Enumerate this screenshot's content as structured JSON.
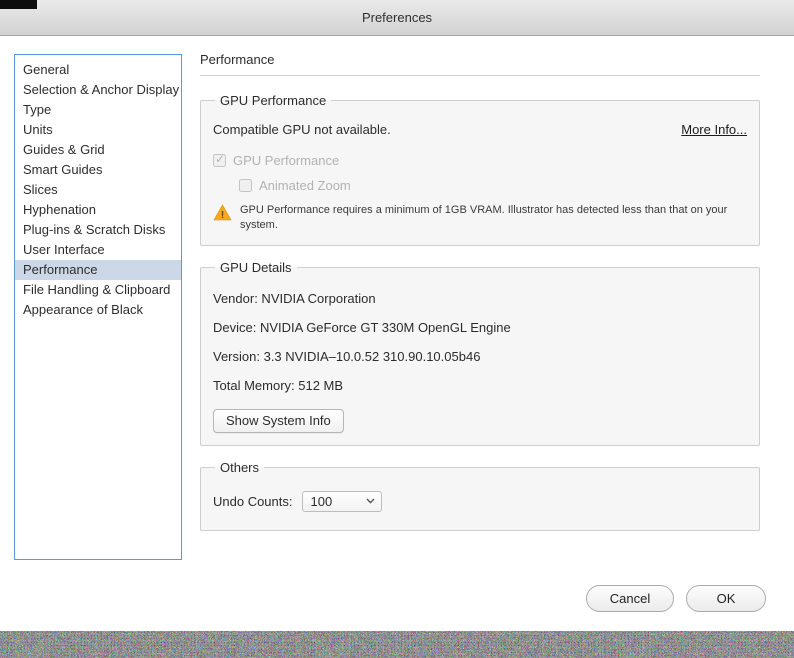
{
  "window": {
    "title": "Preferences"
  },
  "sidebar": {
    "items": [
      "General",
      "Selection & Anchor Display",
      "Type",
      "Units",
      "Guides & Grid",
      "Smart Guides",
      "Slices",
      "Hyphenation",
      "Plug-ins & Scratch Disks",
      "User Interface",
      "Performance",
      "File Handling & Clipboard",
      "Appearance of Black"
    ],
    "selected_item": "Performance"
  },
  "main": {
    "title": "Performance",
    "gpu_performance": {
      "group_label": "GPU Performance",
      "status_text": "Compatible GPU not available.",
      "more_info_link": "More Info...",
      "gpu_checkbox_label": "GPU Performance",
      "gpu_checkbox_checked": true,
      "gpu_checkbox_disabled": true,
      "animated_zoom_label": "Animated Zoom",
      "animated_zoom_checked": false,
      "animated_zoom_disabled": true,
      "warning_text": "GPU Performance requires a minimum of 1GB VRAM. Illustrator has detected less than that on your system."
    },
    "gpu_details": {
      "group_label": "GPU Details",
      "vendor": "Vendor: NVIDIA Corporation",
      "device": "Device: NVIDIA GeForce GT 330M OpenGL Engine",
      "version": "Version: 3.3 NVIDIA–10.0.52 310.90.10.05b46",
      "total_memory": "Total Memory: 512 MB",
      "show_system_info_button": "Show System Info"
    },
    "others": {
      "group_label": "Others",
      "undo_counts_label": "Undo Counts:",
      "undo_counts_value": "100"
    }
  },
  "footer": {
    "cancel_label": "Cancel",
    "ok_label": "OK"
  },
  "colors": {
    "sidebar_border": "#5b9bd5",
    "selected_item_bg": "#ccd8e8",
    "warning_yellow": "#f7a81c",
    "group_bg": "#f6f6f6"
  }
}
